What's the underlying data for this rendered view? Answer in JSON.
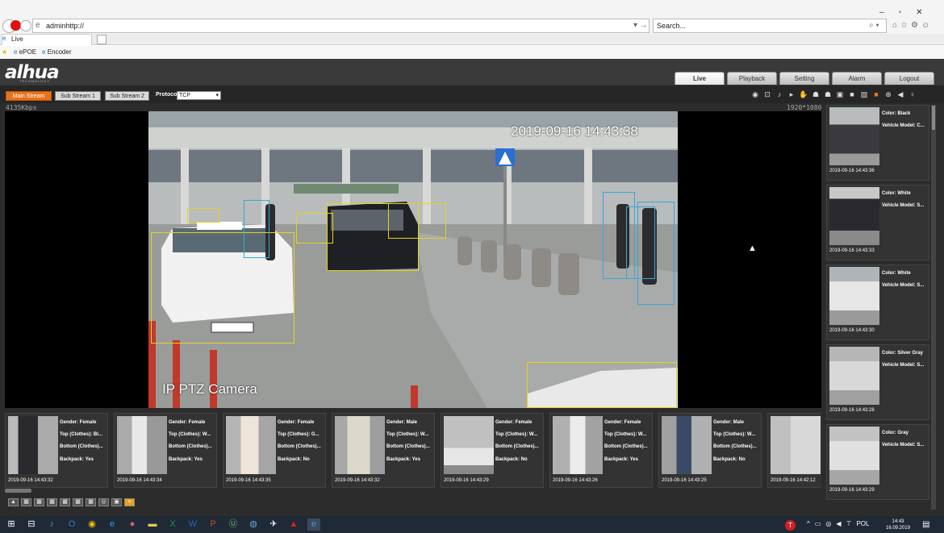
{
  "browser": {
    "address": "adminhttp://",
    "search_placeholder": "Search...",
    "tab_title": "Live",
    "favorites": [
      "ePOE",
      "Encoder"
    ]
  },
  "app": {
    "logo": "alhua",
    "logo_sub": "TECHNOLOGY",
    "nav_tabs": [
      "Live",
      "Playback",
      "Setting",
      "Alarm",
      "Logout"
    ],
    "active_tab": "Live",
    "streams": [
      "Main Stream",
      "Sub Stream 1",
      "Sub Stream 2"
    ],
    "protocol_label": "Protocol",
    "protocol_value": "TCP",
    "bitrate": "4135Kbps",
    "resolution": "1920*1080"
  },
  "video": {
    "osd_time": "2019-09-16 14:43:38",
    "osd_camera": "IP PTZ Camera"
  },
  "vehicle_events": [
    {
      "color": "Color: Black",
      "model": "Vehicle Model: C...",
      "time": "2019-09-16 14:43:36"
    },
    {
      "color": "Color: White",
      "model": "Vehicle Model: S...",
      "time": "2019-09-16 14:43:33"
    },
    {
      "color": "Color: White",
      "model": "Vehicle Model: S...",
      "time": "2019-09-16 14:43:30"
    },
    {
      "color": "Color: Silver Gray",
      "model": "Vehicle Model: S...",
      "time": "2019-09-16 14:43:28"
    },
    {
      "color": "Color: Gray",
      "model": "Vehicle Model: S...",
      "time": "2019-09-16 14:43:29"
    }
  ],
  "human_events": [
    {
      "gender": "Gender: Female",
      "top": "Top (Clothes): Bl...",
      "bottom": "Bottom (Clothes)...",
      "backpack": "Backpack: Yes",
      "time": "2019-09-16 14:43:32"
    },
    {
      "gender": "Gender: Female",
      "top": "Top (Clothes): W...",
      "bottom": "Bottom (Clothes)...",
      "backpack": "Backpack: Yes",
      "time": "2019-09-16 14:43:34"
    },
    {
      "gender": "Gender: Female",
      "top": "Top (Clothes): G...",
      "bottom": "Bottom (Clothes)...",
      "backpack": "Backpack: No",
      "time": "2019-09-16 14:43:35"
    },
    {
      "gender": "Gender: Male",
      "top": "Top (Clothes): W...",
      "bottom": "Bottom (Clothes)...",
      "backpack": "Backpack: Yes",
      "time": "2019-09-16 14:43:32"
    },
    {
      "gender": "Gender: Female",
      "top": "Top (Clothes): W...",
      "bottom": "Bottom (Clothes)...",
      "backpack": "Backpack: No",
      "time": "2019-09-16 14:43:29"
    },
    {
      "gender": "Gender: Female",
      "top": "Top (Clothes): W...",
      "bottom": "Bottom (Clothes)...",
      "backpack": "Backpack: Yes",
      "time": "2019-09-16 14:43:26"
    },
    {
      "gender": "Gender: Male",
      "top": "Top (Clothes): W...",
      "bottom": "Bottom (Clothes)...",
      "backpack": "Backpack: No",
      "time": "2019-09-16 14:43:25"
    },
    {
      "gender": "",
      "top": "",
      "bottom": "",
      "backpack": "",
      "time": "2019-09-16 14:42:12"
    }
  ],
  "taskbar": {
    "tray_lang": "POL",
    "clock_time": "14:43",
    "clock_date": "16.09.2019"
  },
  "colors": {
    "accent": "#e8731b",
    "box_vehicle": "#e6d21e",
    "box_human": "#3aa6d8"
  }
}
